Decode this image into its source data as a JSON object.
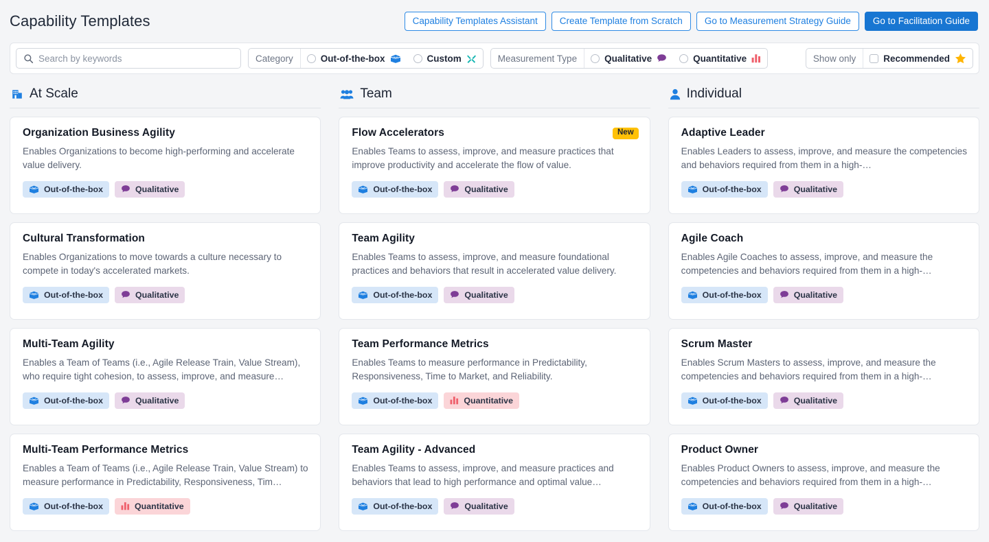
{
  "header": {
    "title": "Capability Templates",
    "actions": [
      {
        "label": "Capability Templates Assistant",
        "primary": false
      },
      {
        "label": "Create Template from Scratch",
        "primary": false
      },
      {
        "label": "Go to Measurement Strategy Guide",
        "primary": false
      },
      {
        "label": "Go to Facilitation Guide",
        "primary": true
      }
    ]
  },
  "filters": {
    "search": {
      "placeholder": "Search by keywords",
      "value": "",
      "icon": "search-icon"
    },
    "category": {
      "label": "Category",
      "options": [
        {
          "label": "Out-of-the-box",
          "icon": "open-box-icon",
          "selected": false
        },
        {
          "label": "Custom",
          "icon": "tools-icon",
          "selected": false
        }
      ]
    },
    "measurement_type": {
      "label": "Measurement Type",
      "options": [
        {
          "label": "Qualitative",
          "icon": "speech-bubble-icon",
          "selected": false
        },
        {
          "label": "Quantitative",
          "icon": "bar-chart-icon",
          "selected": false
        }
      ]
    },
    "show_only": {
      "label": "Show only",
      "options": [
        {
          "label": "Recommended",
          "icon": "star-icon",
          "checked": false
        }
      ]
    }
  },
  "colors": {
    "primary": "#1876d2",
    "link": "#1e7fe0",
    "new_badge": "#ffc107",
    "star": "#ffb400",
    "tag_ootb_bg": "#d6e6f8",
    "tag_qualitative_bg": "#ead9ea",
    "tag_quantitative_bg": "#fbd5d8",
    "qualitative_icon": "#7e3d96",
    "quantitative_icon": "#ef5f6b",
    "ootb_icon": "#1e7fe0",
    "custom_icon": "#13b5b1",
    "page_bg": "#f4f5f7"
  },
  "columns": [
    {
      "title": "At Scale",
      "icon": "building-icon",
      "cards": [
        {
          "title": "Organization Business Agility",
          "description": "Enables Organizations to become high-performing and accelerate value delivery.",
          "badge": "",
          "tags": [
            {
              "label": "Out-of-the-box",
              "type": "ootb",
              "icon": "open-box-icon"
            },
            {
              "label": "Qualitative",
              "type": "qualitative",
              "icon": "speech-bubble-icon"
            }
          ]
        },
        {
          "title": "Cultural Transformation",
          "description": "Enables Organizations to move towards a culture necessary to compete in today's accelerated markets.",
          "badge": "",
          "tags": [
            {
              "label": "Out-of-the-box",
              "type": "ootb",
              "icon": "open-box-icon"
            },
            {
              "label": "Qualitative",
              "type": "qualitative",
              "icon": "speech-bubble-icon"
            }
          ]
        },
        {
          "title": "Multi-Team Agility",
          "description": "Enables a Team of Teams (i.e., Agile Release Train, Value Stream), who require tight cohesion, to assess, improve, and measure…",
          "badge": "",
          "tags": [
            {
              "label": "Out-of-the-box",
              "type": "ootb",
              "icon": "open-box-icon"
            },
            {
              "label": "Qualitative",
              "type": "qualitative",
              "icon": "speech-bubble-icon"
            }
          ]
        },
        {
          "title": "Multi-Team Performance Metrics",
          "description": "Enables a Team of Teams (i.e., Agile Release Train, Value Stream) to measure performance in Predictability, Responsiveness, Tim…",
          "badge": "",
          "tags": [
            {
              "label": "Out-of-the-box",
              "type": "ootb",
              "icon": "open-box-icon"
            },
            {
              "label": "Quantitative",
              "type": "quantitative",
              "icon": "bar-chart-icon"
            }
          ]
        }
      ]
    },
    {
      "title": "Team",
      "icon": "people-group-icon",
      "cards": [
        {
          "title": "Flow Accelerators",
          "description": "Enables Teams to assess, improve, and measure practices that improve productivity and accelerate the flow of value.",
          "badge": "New",
          "tags": [
            {
              "label": "Out-of-the-box",
              "type": "ootb",
              "icon": "open-box-icon"
            },
            {
              "label": "Qualitative",
              "type": "qualitative",
              "icon": "speech-bubble-icon"
            }
          ]
        },
        {
          "title": "Team Agility",
          "description": "Enables Teams to assess, improve, and measure foundational practices and behaviors that result in accelerated value delivery.",
          "badge": "",
          "tags": [
            {
              "label": "Out-of-the-box",
              "type": "ootb",
              "icon": "open-box-icon"
            },
            {
              "label": "Qualitative",
              "type": "qualitative",
              "icon": "speech-bubble-icon"
            }
          ]
        },
        {
          "title": "Team Performance Metrics",
          "description": "Enables Teams to measure performance in Predictability, Responsiveness, Time to Market, and Reliability.",
          "badge": "",
          "tags": [
            {
              "label": "Out-of-the-box",
              "type": "ootb",
              "icon": "open-box-icon"
            },
            {
              "label": "Quantitative",
              "type": "quantitative",
              "icon": "bar-chart-icon"
            }
          ]
        },
        {
          "title": "Team Agility - Advanced",
          "description": "Enables Teams to assess, improve, and measure practices and behaviors that lead to high performance and optimal value…",
          "badge": "",
          "tags": [
            {
              "label": "Out-of-the-box",
              "type": "ootb",
              "icon": "open-box-icon"
            },
            {
              "label": "Qualitative",
              "type": "qualitative",
              "icon": "speech-bubble-icon"
            }
          ]
        }
      ]
    },
    {
      "title": "Individual",
      "icon": "person-icon",
      "cards": [
        {
          "title": "Adaptive Leader",
          "description": "Enables Leaders to assess, improve, and measure the competencies and behaviors required from them in a high-…",
          "badge": "",
          "tags": [
            {
              "label": "Out-of-the-box",
              "type": "ootb",
              "icon": "open-box-icon"
            },
            {
              "label": "Qualitative",
              "type": "qualitative",
              "icon": "speech-bubble-icon"
            }
          ]
        },
        {
          "title": "Agile Coach",
          "description": "Enables Agile Coaches to assess, improve, and measure the competencies and behaviors required from them in a high-…",
          "badge": "",
          "tags": [
            {
              "label": "Out-of-the-box",
              "type": "ootb",
              "icon": "open-box-icon"
            },
            {
              "label": "Qualitative",
              "type": "qualitative",
              "icon": "speech-bubble-icon"
            }
          ]
        },
        {
          "title": "Scrum Master",
          "description": "Enables Scrum Masters to assess, improve, and measure the competencies and behaviors required from them in a high-…",
          "badge": "",
          "tags": [
            {
              "label": "Out-of-the-box",
              "type": "ootb",
              "icon": "open-box-icon"
            },
            {
              "label": "Qualitative",
              "type": "qualitative",
              "icon": "speech-bubble-icon"
            }
          ]
        },
        {
          "title": "Product Owner",
          "description": "Enables Product Owners to assess, improve, and measure the competencies and behaviors required from them in a high-…",
          "badge": "",
          "tags": [
            {
              "label": "Out-of-the-box",
              "type": "ootb",
              "icon": "open-box-icon"
            },
            {
              "label": "Qualitative",
              "type": "qualitative",
              "icon": "speech-bubble-icon"
            }
          ]
        }
      ]
    }
  ]
}
